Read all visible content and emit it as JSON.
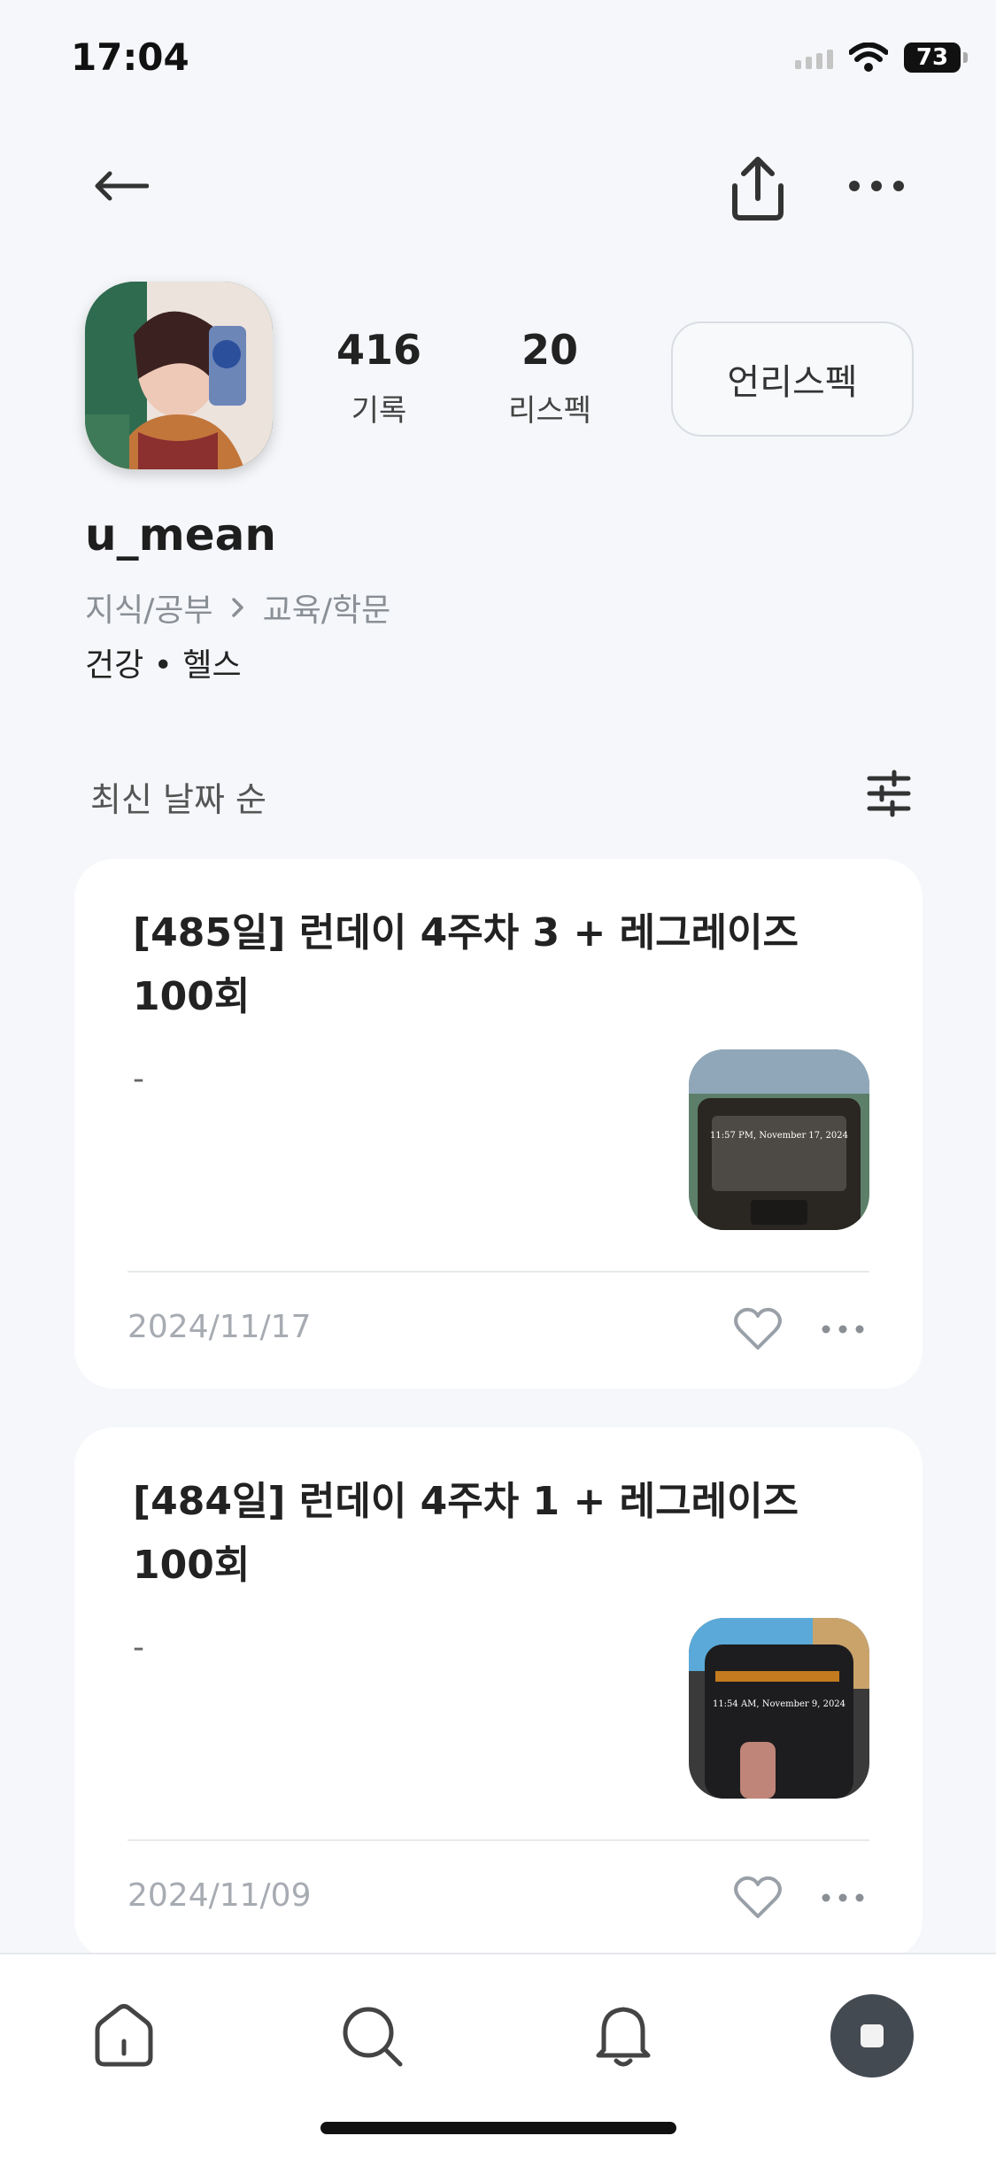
{
  "status_bar": {
    "time": "17:04",
    "battery": "73"
  },
  "profile": {
    "records_count": "416",
    "records_label": "기록",
    "lispec_count": "20",
    "lispec_label": "리스펙",
    "unspec_button": "언리스펙",
    "username": "u_mean",
    "category_parent": "지식/공부",
    "category_child": "교육/학문",
    "tags": "건강 • 헬스"
  },
  "sort": {
    "label": "최신 날짜 순"
  },
  "posts": [
    {
      "title": "[485일] 런데이 4주차 3 + 레그레이즈 100회",
      "description": "-",
      "date": "2024/11/17",
      "thumb_caption": "11:57 PM, November 17, 2024"
    },
    {
      "title": "[484일] 런데이 4주차 1 + 레그레이즈 100회",
      "description": "-",
      "date": "2024/11/09",
      "thumb_caption": "11:54 AM, November 9, 2024"
    }
  ],
  "colors": {
    "background": "#f5f7fa",
    "card": "#ffffff",
    "muted_text": "#a7abb2",
    "profile_fab": "#444a52"
  },
  "icons": [
    "back-arrow-icon",
    "share-icon",
    "more-icon",
    "filter-icon",
    "heart-icon",
    "home-icon",
    "search-icon",
    "bell-icon",
    "profile-icon"
  ]
}
